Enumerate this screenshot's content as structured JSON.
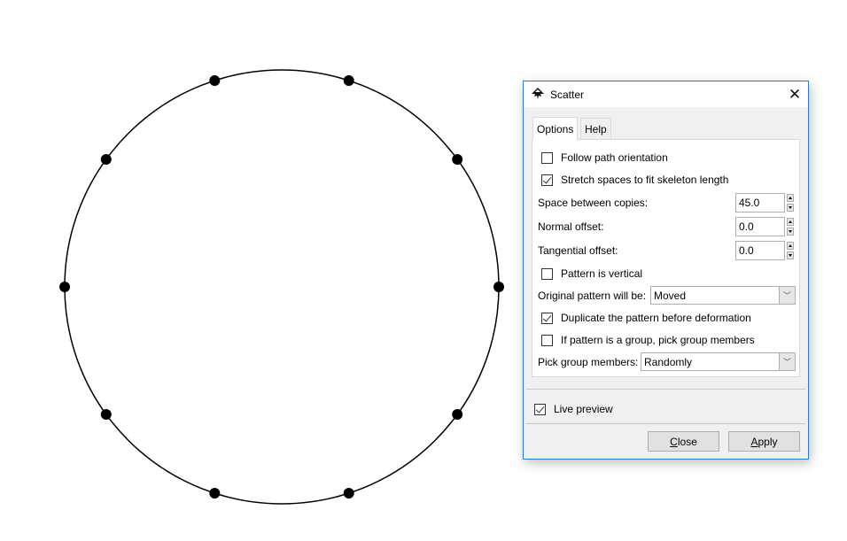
{
  "canvas": {
    "shape": "circle",
    "stroke_color": "#000000",
    "dot_color": "#000000",
    "dot_count": 10
  },
  "dialog": {
    "title": "Scatter",
    "icon": "inkscape-logo-icon",
    "close_icon": "close-icon",
    "tabs": [
      {
        "label": "Options",
        "active": true
      },
      {
        "label": "Help",
        "active": false
      }
    ],
    "options": {
      "follow_path_orientation": {
        "label": "Follow path orientation",
        "checked": false
      },
      "stretch_spaces": {
        "label": "Stretch spaces to fit skeleton length",
        "checked": true
      },
      "space_between_copies": {
        "label": "Space between copies:",
        "value": "45.0"
      },
      "normal_offset": {
        "label": "Normal offset:",
        "value": "0.0"
      },
      "tangential_offset": {
        "label": "Tangential offset:",
        "value": "0.0"
      },
      "pattern_vertical": {
        "label": "Pattern is vertical",
        "checked": false
      },
      "original_pattern": {
        "label": "Original pattern will be:",
        "value": "Moved"
      },
      "duplicate_pattern": {
        "label": "Duplicate the pattern before deformation",
        "checked": true
      },
      "pick_group_members_toggle": {
        "label": "If pattern is a group, pick group members",
        "checked": false
      },
      "pick_group_members": {
        "label": "Pick group members:",
        "value": "Randomly"
      }
    },
    "live_preview": {
      "label": "Live preview",
      "checked": true
    },
    "buttons": {
      "close": {
        "mnemonic": "C",
        "rest": "lose"
      },
      "apply": {
        "mnemonic": "A",
        "rest": "pply"
      }
    },
    "accent_color": "#2b7bd3"
  }
}
